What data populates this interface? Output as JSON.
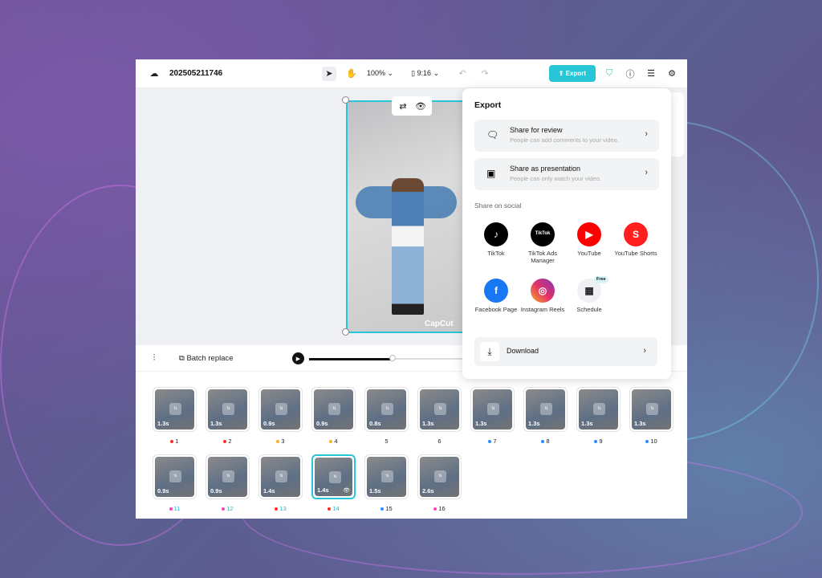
{
  "project": {
    "title": "202505211746",
    "zoom": "100%",
    "ratio": "9:16"
  },
  "toolbar": {
    "export": "Export",
    "batch_replace": "Batch replace"
  },
  "export_panel": {
    "title": "Export",
    "options": [
      {
        "title": "Share for review",
        "subtitle": "People can add comments to your video."
      },
      {
        "title": "Share as presentation",
        "subtitle": "People can only watch your video."
      }
    ],
    "social_heading": "Share on social",
    "social": [
      {
        "name": "TikTok",
        "color": "#000000"
      },
      {
        "name": "TikTok Ads Manager",
        "color": "#000000",
        "logo": "TikTok"
      },
      {
        "name": "YouTube",
        "color": "#ff0000"
      },
      {
        "name": "YouTube Shorts",
        "color": "#ff1f1f"
      },
      {
        "name": "Facebook Page",
        "color": "#1877f2"
      },
      {
        "name": "Instagram Reels",
        "color": "#d62976"
      },
      {
        "name": "Schedule",
        "color": "#eef0f3",
        "badge": "Free"
      }
    ],
    "download": "Download"
  },
  "preview": {
    "watermark": "CapCut"
  },
  "clips": [
    {
      "n": "1",
      "dur": "1.3s",
      "dot": "#ff2a2a"
    },
    {
      "n": "2",
      "dur": "1.3s",
      "dot": "#ff2a2a"
    },
    {
      "n": "3",
      "dur": "0.9s",
      "dot": "#ffae2a"
    },
    {
      "n": "4",
      "dur": "0.9s",
      "dot": "#ffae2a"
    },
    {
      "n": "5",
      "dur": "0.8s",
      "dot": ""
    },
    {
      "n": "6",
      "dur": "1.3s",
      "dot": ""
    },
    {
      "n": "7",
      "dur": "1.3s",
      "dot": "#2a8cff"
    },
    {
      "n": "8",
      "dur": "1.3s",
      "dot": "#2a8cff"
    },
    {
      "n": "9",
      "dur": "1.3s",
      "dot": "#2a8cff"
    },
    {
      "n": "10",
      "dur": "1.3s",
      "dot": "#2a8cff"
    },
    {
      "n": "11",
      "dur": "0.9s",
      "dot": "#ff3fb5",
      "lc": "#1fb8d6"
    },
    {
      "n": "12",
      "dur": "0.9s",
      "dot": "#ff3fb5",
      "lc": "#1fb8d6"
    },
    {
      "n": "13",
      "dur": "1.4s",
      "dot": "#ff2a2a",
      "lc": "#1fb8d6"
    },
    {
      "n": "14",
      "dur": "1.4s",
      "dot": "#ff2a2a",
      "lc": "#1fb8d6",
      "active": true
    },
    {
      "n": "15",
      "dur": "1.5s",
      "dot": "#2a8cff"
    },
    {
      "n": "16",
      "dur": "2.6s",
      "dot": "#ff3fb5"
    }
  ],
  "playback_progress": 0.52,
  "accent": "#27c6d6"
}
